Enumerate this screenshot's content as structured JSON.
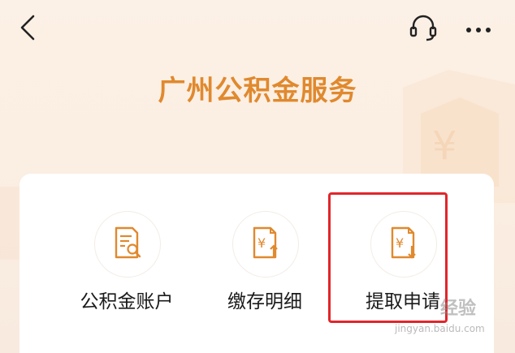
{
  "header": {
    "title": "广州公积金服务"
  },
  "services": [
    {
      "label": "公积金账户",
      "icon": "account-doc-search-icon"
    },
    {
      "label": "缴存明细",
      "icon": "yuan-doc-up-icon"
    },
    {
      "label": "提取申请",
      "icon": "yuan-doc-down-icon"
    }
  ],
  "colors": {
    "accent": "#e0892e",
    "highlight": "#e1262b",
    "background": "#fcf1e6"
  },
  "watermark": {
    "text": "经验",
    "sub": "jingyan.baidu.com"
  }
}
